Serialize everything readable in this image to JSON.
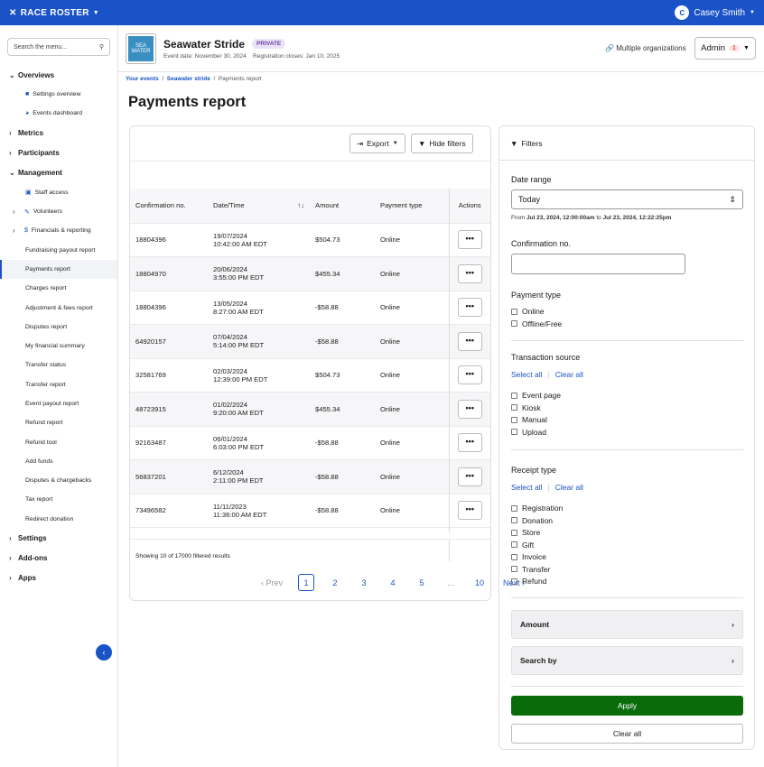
{
  "topbar": {
    "brand": "RACE ROSTER",
    "user_initial": "C",
    "user_name": "Casey Smith"
  },
  "sidebar": {
    "search_placeholder": "Search the menu...",
    "sections": {
      "overviews": "Overviews",
      "settings_overview": "Settings overview",
      "events_dashboard": "Events dashboard",
      "metrics": "Metrics",
      "participants": "Participants",
      "management": "Management",
      "staff_access": "Staff access",
      "volunteers": "Volunteers",
      "financials": "Financials & reporting",
      "settings": "Settings",
      "addons": "Add-ons",
      "apps": "Apps"
    },
    "financial_items": [
      "Fundraising payout report",
      "Payments report",
      "Charges report",
      "Adjustment & fees report",
      "Disputes report",
      "My financial summary",
      "Transfer status",
      "Transfer report",
      "Event payout report",
      "Refund report",
      "Refund tool",
      "Add funds",
      "Disputes & chargebacks",
      "Tax report",
      "Redirect donation"
    ]
  },
  "header": {
    "logo_text": "SEA WATER",
    "event_name": "Seawater Stride",
    "badge": "PRIVATE",
    "event_date": "Event date: November 30, 2024",
    "reg_closes": "Registration closes: Jan 10, 2025",
    "multi_org": "Multiple organizations",
    "admin_label": "Admin",
    "admin_count": "1"
  },
  "breadcrumb": {
    "c1": "Your events",
    "c2": "Seawater stride",
    "c3": "Payments report"
  },
  "page_title": "Payments report",
  "toolbar": {
    "export": "Export",
    "hide_filters": "Hide filters"
  },
  "table": {
    "headers": {
      "conf": "Confirmation no.",
      "date": "Date/Time",
      "amount": "Amount",
      "ptype": "Payment type",
      "actions": "Actions"
    },
    "rows": [
      {
        "conf": "18804396",
        "date": "19/07/2024",
        "time": "10:42:00 AM EDT",
        "amount": "$504.73",
        "ptype": "Online"
      },
      {
        "conf": "18804970",
        "date": "20/06/2024",
        "time": "3:55:00 PM EDT",
        "amount": "$455.34",
        "ptype": "Online"
      },
      {
        "conf": "18804396",
        "date": "13/05/2024",
        "time": "8:27:00 AM EDT",
        "amount": "-$58.88",
        "ptype": "Online"
      },
      {
        "conf": "64920157",
        "date": "07/04/2024",
        "time": "5:14:00 PM EDT",
        "amount": "-$58.88",
        "ptype": "Online"
      },
      {
        "conf": "32581769",
        "date": "02/03/2024",
        "time": "12:39:00 PM EDT",
        "amount": "$504.73",
        "ptype": "Online"
      },
      {
        "conf": "48723915",
        "date": "01/02/2024",
        "time": "9:20:00 AM EDT",
        "amount": "$455.34",
        "ptype": "Online"
      },
      {
        "conf": "92163487",
        "date": "06/01/2024",
        "time": "6:03:00 PM EDT",
        "amount": "-$58.88",
        "ptype": "Online"
      },
      {
        "conf": "56837201",
        "date": "6/12/2024",
        "time": "2:11:00 PM EDT",
        "amount": "-$58.88",
        "ptype": "Online"
      },
      {
        "conf": "73496582",
        "date": "11/11/2023",
        "time": "11:36:00 AM EDT",
        "amount": "-$58.88",
        "ptype": "Online"
      }
    ],
    "action_label": "•••",
    "results_text": "Showing 10 of 17000 filtered results"
  },
  "pager": {
    "prev": "‹ Prev",
    "pages": [
      "1",
      "2",
      "3",
      "4",
      "5",
      "...",
      "10"
    ],
    "next": "Next ›"
  },
  "filters": {
    "title": "Filters",
    "date_range_label": "Date range",
    "date_range_value": "Today",
    "date_hint_from": "From ",
    "date_hint_start": "Jul 23, 2024, 12:00:00am",
    "date_hint_to": " to ",
    "date_hint_end": "Jul 23, 2024, 12:22:25pm",
    "conf_label": "Confirmation no.",
    "payment_type_label": "Payment type",
    "payment_types": [
      "Online",
      "Offline/Free"
    ],
    "tx_source_label": "Transaction source",
    "select_all": "Select all",
    "clear_all_link": "Clear all",
    "tx_sources": [
      "Event page",
      "Kiosk",
      "Manual",
      "Upload"
    ],
    "receipt_type_label": "Receipt type",
    "receipt_types": [
      "Registration",
      "Donation",
      "Store",
      "Gift",
      "Invoice",
      "Transfer",
      "Refund"
    ],
    "amount_label": "Amount",
    "search_by_label": "Search by",
    "apply": "Apply",
    "clear_all": "Clear all"
  }
}
